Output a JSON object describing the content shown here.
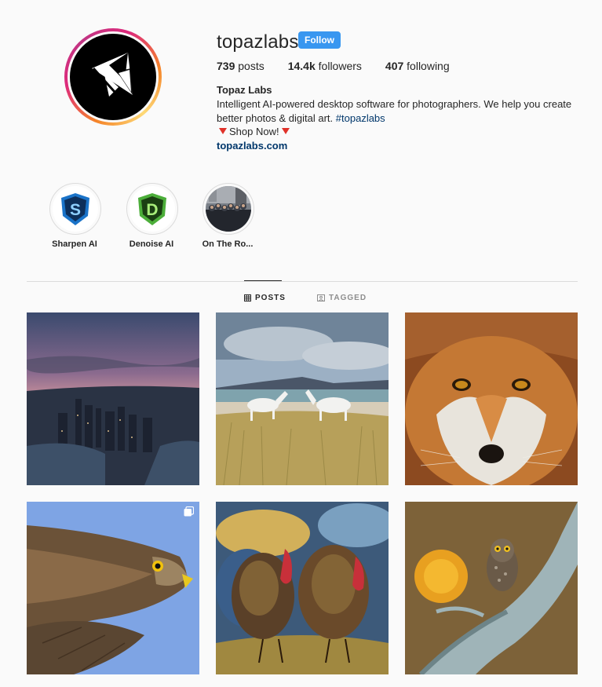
{
  "profile": {
    "username": "topazlabs",
    "follow_label": "Follow",
    "posts_count": "739",
    "posts_label": "posts",
    "followers_count": "14.4k",
    "followers_label": "followers",
    "following_count": "407",
    "following_label": "following",
    "display_name": "Topaz Labs",
    "bio_text": "Intelligent AI-powered desktop software for photographers. We help you create better photos & digital art.",
    "bio_hashtag": "#topazlabs",
    "shop_text": "Shop Now!",
    "website": "topazlabs.com"
  },
  "highlights": [
    {
      "label": "Sharpen AI",
      "icon": "sharpen-ai-logo"
    },
    {
      "label": "Denoise AI",
      "icon": "denoise-ai-logo"
    },
    {
      "label": "On The Ro...",
      "icon": "group-photo"
    }
  ],
  "tabs": [
    {
      "label": "POSTS",
      "active": true,
      "icon": "grid-icon"
    },
    {
      "label": "TAGGED",
      "active": false,
      "icon": "tag-icon"
    }
  ],
  "posts": [
    {
      "subject": "city skyline at dusk"
    },
    {
      "subject": "white horses on beach dunes"
    },
    {
      "subject": "red fox face"
    },
    {
      "subject": "hawk in flight",
      "multi": true
    },
    {
      "subject": "wild turkeys painting"
    },
    {
      "subject": "pygmy owl on branch"
    }
  ],
  "colors": {
    "accent": "#3897f0",
    "link": "#00376b",
    "text": "#262626",
    "muted": "#8e8e8e",
    "background": "#fafafa"
  }
}
